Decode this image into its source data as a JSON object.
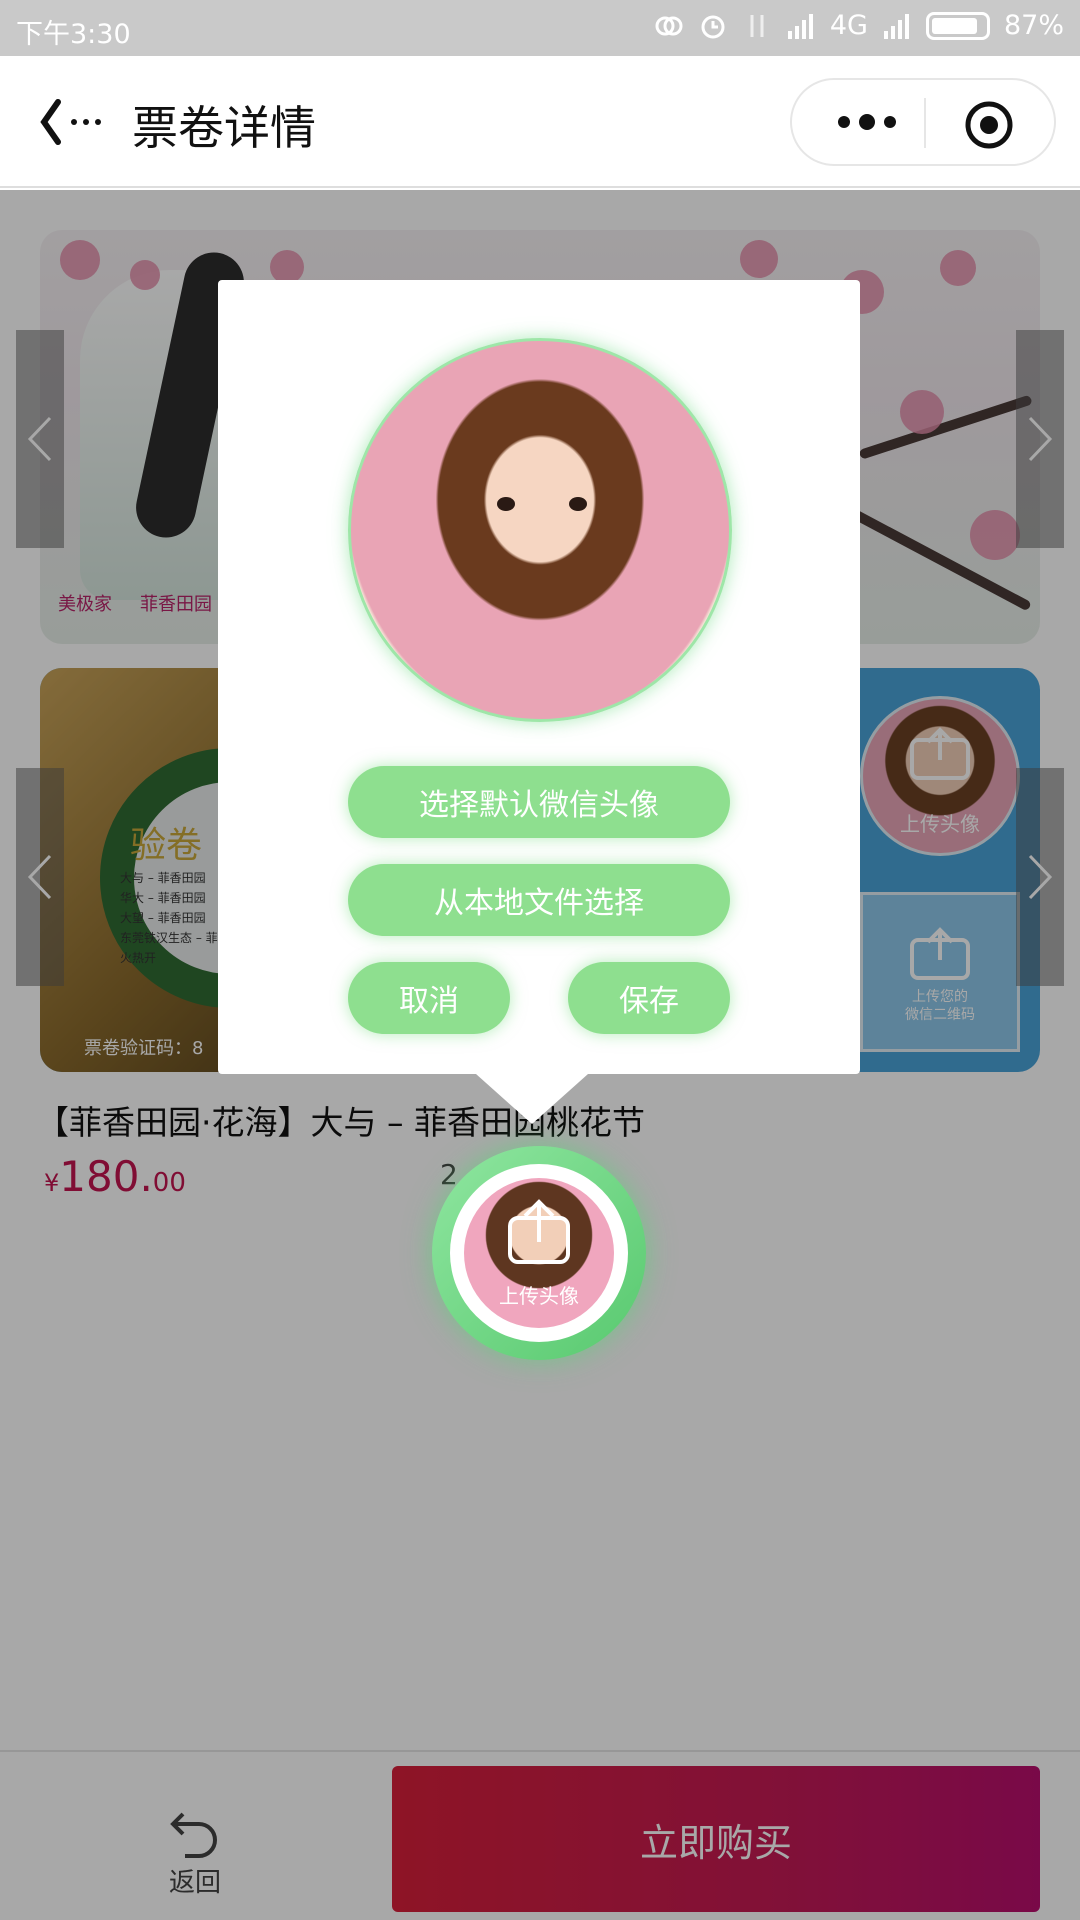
{
  "status_bar": {
    "time": "下午3:30",
    "network": "4G",
    "battery": "87%",
    "battery_level": 0.87
  },
  "nav": {
    "title": "票卷详情",
    "back_icon": "back-arrow-icon",
    "more_icon": "more-dots-icon",
    "capsule_close_icon": "target-circle-icon"
  },
  "banner": {
    "logo_left": "美极家",
    "logo_right": "菲香田园"
  },
  "ticket": {
    "verify_title": "验卷",
    "verify_lines": [
      "大与 – 菲香田园",
      "华大 – 菲香田园",
      "大望 – 菲香田园",
      "东莞铁汉生态 – 菲",
      "火热开"
    ],
    "verify_code_label": "票卷验证码：8",
    "avatar_slot_label": "上传头像",
    "qr_slot_label": "上传您的\n微信二维码"
  },
  "product": {
    "title": "【菲香田园·花海】大与 – 菲香田园桃花节",
    "price_currency": "¥",
    "price_integer": "180.",
    "price_decimal": "00",
    "sub_info": "2      m"
  },
  "popup": {
    "btn_default_avatar": "选择默认微信头像",
    "btn_local_file": "从本地文件选择",
    "btn_cancel": "取消",
    "btn_save": "保存"
  },
  "floating_avatar": {
    "label": "上传头像",
    "icon": "upload-icon"
  },
  "bottom_bar": {
    "return_label": "返回",
    "return_icon": "return-arrow-icon",
    "buy_label": "立即购买"
  },
  "colors": {
    "accent_green": "#8edf8f",
    "buy_red": "#d81f3a",
    "price_red": "#c3144f"
  }
}
